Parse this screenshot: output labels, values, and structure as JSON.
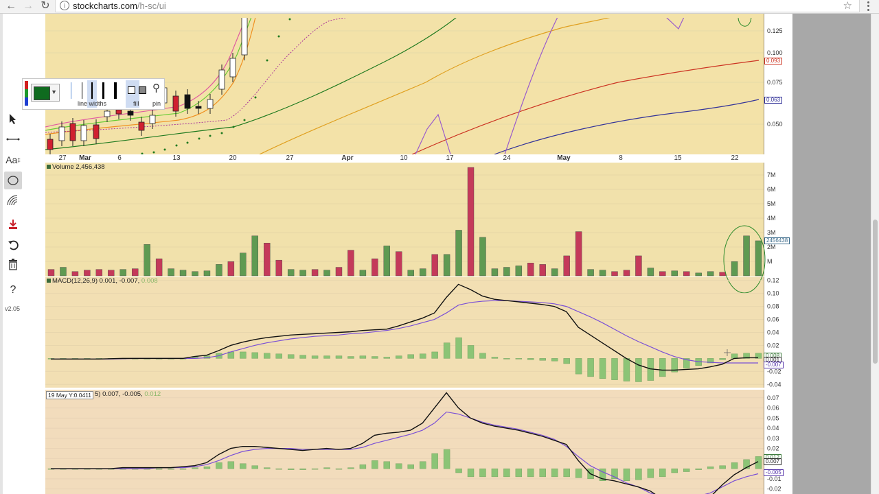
{
  "browser": {
    "url_host": "stockcharts.com",
    "url_path": "/h-sc/ui"
  },
  "toolbar": {
    "version": "v2.05",
    "tools": [
      "pointer-tool",
      "line-tool",
      "text-tool",
      "ellipse-tool",
      "fibonacci-arc-tool",
      "save-tool",
      "undo-tool",
      "delete-tool",
      "help-tool"
    ],
    "help_label": "?"
  },
  "style_toolbar": {
    "line_widths_label": "line widths",
    "fill_label": "fill",
    "pin_label": "pin",
    "selected_color": "#0f6b1f",
    "rgb": [
      "#d11f1f",
      "#1e9a2c",
      "#1f3fd1"
    ]
  },
  "price_axis": {
    "ticks": [
      "0.125",
      "0.100",
      "0.075",
      "0.050"
    ],
    "tags": [
      {
        "text": "0.093",
        "color": "#cc3322"
      },
      {
        "text": "0.063",
        "color": "#333399"
      }
    ]
  },
  "date_axis": {
    "ticks": [
      {
        "label": "27",
        "major": false
      },
      {
        "label": "Mar",
        "major": true
      },
      {
        "label": "6",
        "major": false
      },
      {
        "label": "13",
        "major": false
      },
      {
        "label": "20",
        "major": false
      },
      {
        "label": "27",
        "major": false
      },
      {
        "label": "Apr",
        "major": true
      },
      {
        "label": "10",
        "major": false
      },
      {
        "label": "17",
        "major": false
      },
      {
        "label": "24",
        "major": false
      },
      {
        "label": "May",
        "major": true
      },
      {
        "label": "8",
        "major": false
      },
      {
        "label": "15",
        "major": false
      },
      {
        "label": "22",
        "major": false
      }
    ]
  },
  "volume": {
    "title": "Volume 2,456,438",
    "axis": [
      "7M",
      "6M",
      "5M",
      "4M",
      "3M",
      "2M",
      "M"
    ],
    "tag": "2456438"
  },
  "macd1": {
    "title_main": "MACD(12,26,9) 0.001, -0.007, ",
    "title_hist": "0.008",
    "axis": [
      "0.12",
      "0.10",
      "0.08",
      "0.06",
      "0.04",
      "0.02",
      "-0.02",
      "-0.04"
    ],
    "tags": [
      {
        "text": "0.008",
        "color": "#3a7a3a"
      },
      {
        "text": "0.001",
        "color": "#222222"
      },
      {
        "text": "-0.007",
        "color": "#5533aa"
      }
    ]
  },
  "macd2": {
    "tooltip": "19 May Y:0.0411",
    "title_main": "5) 0.007, -0.005, ",
    "title_hist": "0.012",
    "axis": [
      "0.07",
      "0.06",
      "0.05",
      "0.04",
      "0.03",
      "0.02",
      "0.01",
      "-0.01",
      "-0.02"
    ],
    "tags": [
      {
        "text": "0.012",
        "color": "#3a7a3a"
      },
      {
        "text": "0.007",
        "color": "#222222"
      },
      {
        "text": "-0.005",
        "color": "#5533aa"
      }
    ]
  },
  "chart_data": [
    {
      "type": "bar",
      "title": "Volume 2,456,438",
      "ylabel": "",
      "ylim": [
        0,
        7500000
      ],
      "series": [
        {
          "name": "Volume",
          "values": [
            450000,
            600000,
            300000,
            400000,
            450000,
            400000,
            450000,
            500000,
            2200000,
            1200000,
            500000,
            400000,
            300000,
            350000,
            800000,
            1000000,
            1600000,
            2800000,
            2300000,
            1100000,
            450000,
            400000,
            450000,
            400000,
            600000,
            1800000,
            400000,
            1200000,
            2100000,
            1700000,
            400000,
            500000,
            1500000,
            1500000,
            3200000,
            7600000,
            2700000,
            500000,
            600000,
            700000,
            900000,
            800000,
            500000,
            1400000,
            3100000,
            450000,
            400000,
            300000,
            400000,
            1400000,
            550000,
            300000,
            350000,
            300000,
            200000,
            300000,
            250000,
            1000000,
            2800000,
            2456438
          ]
        }
      ]
    },
    {
      "type": "line",
      "title": "MACD(12,26,9) 0.001, -0.007, 0.008",
      "ylim": [
        -0.045,
        0.125
      ],
      "series": [
        {
          "name": "MACD",
          "values": [
            -0.001,
            -0.001,
            -0.001,
            -0.001,
            -0.001,
            -0.0005,
            0,
            0,
            0,
            0,
            0,
            0,
            0.003,
            0.005,
            0.012,
            0.02,
            0.025,
            0.029,
            0.032,
            0.034,
            0.036,
            0.037,
            0.038,
            0.039,
            0.04,
            0.041,
            0.043,
            0.044,
            0.045,
            0.05,
            0.056,
            0.062,
            0.07,
            0.094,
            0.114,
            0.106,
            0.096,
            0.091,
            0.089,
            0.087,
            0.085,
            0.083,
            0.08,
            0.072,
            0.048,
            0.036,
            0.024,
            0.012,
            0,
            -0.01,
            -0.016,
            -0.018,
            -0.018,
            -0.017,
            -0.016,
            -0.013,
            -0.009,
            0,
            0.001,
            0.001
          ]
        },
        {
          "name": "Signal",
          "values": [
            -0.001,
            -0.001,
            -0.001,
            -0.001,
            -0.001,
            -0.001,
            -0.0005,
            0,
            0,
            0,
            0,
            0,
            0,
            0.001,
            0.004,
            0.01,
            0.015,
            0.02,
            0.024,
            0.027,
            0.03,
            0.032,
            0.034,
            0.035,
            0.036,
            0.038,
            0.039,
            0.041,
            0.043,
            0.046,
            0.05,
            0.055,
            0.06,
            0.07,
            0.082,
            0.086,
            0.088,
            0.089,
            0.089,
            0.088,
            0.087,
            0.086,
            0.084,
            0.08,
            0.072,
            0.064,
            0.055,
            0.045,
            0.035,
            0.026,
            0.018,
            0.01,
            0.003,
            -0.002,
            -0.005,
            -0.006,
            -0.007,
            -0.007,
            -0.007,
            -0.007
          ]
        },
        {
          "name": "Histogram",
          "values": [
            0,
            0,
            0,
            0,
            0,
            0,
            0,
            0,
            0,
            0,
            0,
            0,
            0.003,
            0.004,
            0.008,
            0.01,
            0.01,
            0.009,
            0.008,
            0.007,
            0.006,
            0.005,
            0.004,
            0.004,
            0.004,
            0.003,
            0.004,
            0.003,
            0.002,
            0.004,
            0.006,
            0.007,
            0.01,
            0.024,
            0.032,
            0.02,
            0.008,
            0.002,
            0,
            -0.001,
            -0.002,
            -0.003,
            -0.004,
            -0.008,
            -0.024,
            -0.028,
            -0.031,
            -0.033,
            -0.035,
            -0.036,
            -0.034,
            -0.028,
            -0.021,
            -0.015,
            -0.011,
            -0.007,
            -0.002,
            0.007,
            0.008,
            0.008
          ]
        }
      ]
    },
    {
      "type": "line",
      "title": "5) 0.007, -0.005, 0.012",
      "ylim": [
        -0.025,
        0.075
      ],
      "series": [
        {
          "name": "MACD",
          "values": [
            0,
            0,
            0,
            0,
            0,
            0,
            0.001,
            0.001,
            0.001,
            0.001,
            0.001,
            0.002,
            0.003,
            0.006,
            0.014,
            0.02,
            0.022,
            0.022,
            0.021,
            0.02,
            0.019,
            0.018,
            0.019,
            0.02,
            0.019,
            0.02,
            0.025,
            0.033,
            0.035,
            0.036,
            0.038,
            0.045,
            0.06,
            0.075,
            0.06,
            0.05,
            0.045,
            0.042,
            0.04,
            0.038,
            0.035,
            0.032,
            0.028,
            0.024,
            0.008,
            -0.005,
            -0.01,
            -0.012,
            -0.015,
            -0.018,
            -0.022,
            -0.03,
            -0.034,
            -0.038,
            -0.036,
            -0.028,
            -0.016,
            -0.006,
            0.001,
            0.007
          ]
        },
        {
          "name": "Signal",
          "values": [
            0,
            0,
            0,
            0,
            0,
            0,
            0,
            0,
            0,
            0.001,
            0.001,
            0.001,
            0.002,
            0.004,
            0.008,
            0.013,
            0.017,
            0.019,
            0.02,
            0.02,
            0.02,
            0.019,
            0.019,
            0.019,
            0.019,
            0.019,
            0.021,
            0.025,
            0.028,
            0.031,
            0.034,
            0.038,
            0.045,
            0.056,
            0.054,
            0.05,
            0.046,
            0.043,
            0.041,
            0.039,
            0.036,
            0.033,
            0.029,
            0.022,
            0.012,
            0.003,
            -0.003,
            -0.008,
            -0.014,
            -0.018,
            -0.024,
            -0.028,
            -0.03,
            -0.029,
            -0.027,
            -0.024,
            -0.018,
            -0.012,
            -0.008,
            -0.005
          ]
        },
        {
          "name": "Histogram",
          "values": [
            0,
            0,
            0,
            0,
            0,
            0,
            0,
            0,
            0,
            0,
            0,
            0,
            0.001,
            0.002,
            0.006,
            0.007,
            0.005,
            0.003,
            0.001,
            0,
            -0.001,
            -0.001,
            0,
            0.001,
            0,
            0.001,
            0.004,
            0.008,
            0.007,
            0.005,
            0.004,
            0.007,
            0.015,
            0.019,
            -0.004,
            -0.008,
            -0.008,
            -0.008,
            -0.008,
            -0.008,
            -0.008,
            -0.008,
            -0.008,
            -0.008,
            -0.009,
            -0.01,
            -0.012,
            -0.01,
            -0.012,
            -0.011,
            -0.009,
            -0.008,
            -0.004,
            -0.003,
            -0.001,
            0.002,
            0.003,
            0.006,
            0.009,
            0.012
          ]
        }
      ]
    }
  ]
}
